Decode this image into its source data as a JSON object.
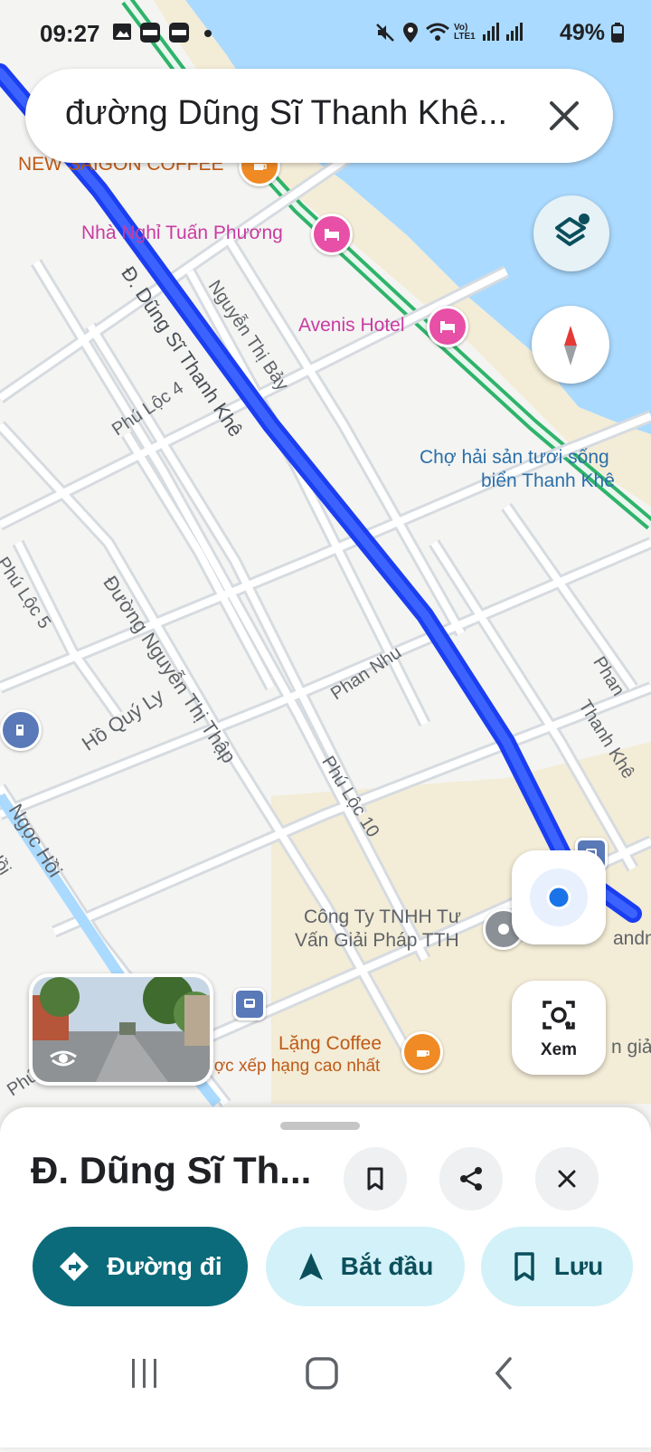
{
  "status_bar": {
    "time": "09:27",
    "battery": "49%",
    "network": "Vo) LTE1"
  },
  "search": {
    "query": "đường Dũng Sĩ Thanh Khê..."
  },
  "map": {
    "pois": {
      "new_saigon_coffee": "NEW SAIGON COFFEE",
      "nha_nghi": "Nhà Nghỉ Tuấn Phương",
      "avenis": "Avenis Hotel",
      "cho_hai_san_line1": "Chợ hải sản tươi sống",
      "cho_hai_san_line2": "biển Thanh Khê",
      "cong_ty_line1": "Công Ty TNHH Tư",
      "cong_ty_line2": "Vấn Giải Pháp TTH",
      "lang_coffee": "Lặng Coffee",
      "lang_coffee_sub": "ược xếp hạng cao nhất",
      "landm": "andm",
      "gia": "n giả"
    },
    "streets": {
      "dung_si": "Đ. Dũng Sĩ Thanh Khê",
      "nguyen_thi_bay": "Nguyễn Thị Bảy",
      "phu_loc_4": "Phú Lộc 4",
      "phu_loc_5": "Phú Lộc 5",
      "nguyen_thi_thap": "Đường Nguyễn Thị Thập",
      "ho_quy_ly": "Hồ Quý Ly",
      "phan_nhu": "Phan Nhu",
      "phu_loc_10": "Phú Lộc 10",
      "ngoc_hoi": "Ngọc Hồi",
      "hoi": "Hồi",
      "phan": "Phan",
      "thanh_khe": "Thanh Khê",
      "phu": "Phú"
    }
  },
  "street_view_button": {
    "label": "Xem"
  },
  "place": {
    "title": "Đ. Dũng Sĩ Th...",
    "buttons": {
      "directions": "Đường đi",
      "start": "Bắt đầu",
      "save": "Lưu"
    }
  },
  "colors": {
    "route": "#1a3ef0",
    "water": "#aadaff",
    "primary_button": "#0b6b7a",
    "tonal_button": "#d3f1f8",
    "tonal_text": "#0b4f5c"
  }
}
